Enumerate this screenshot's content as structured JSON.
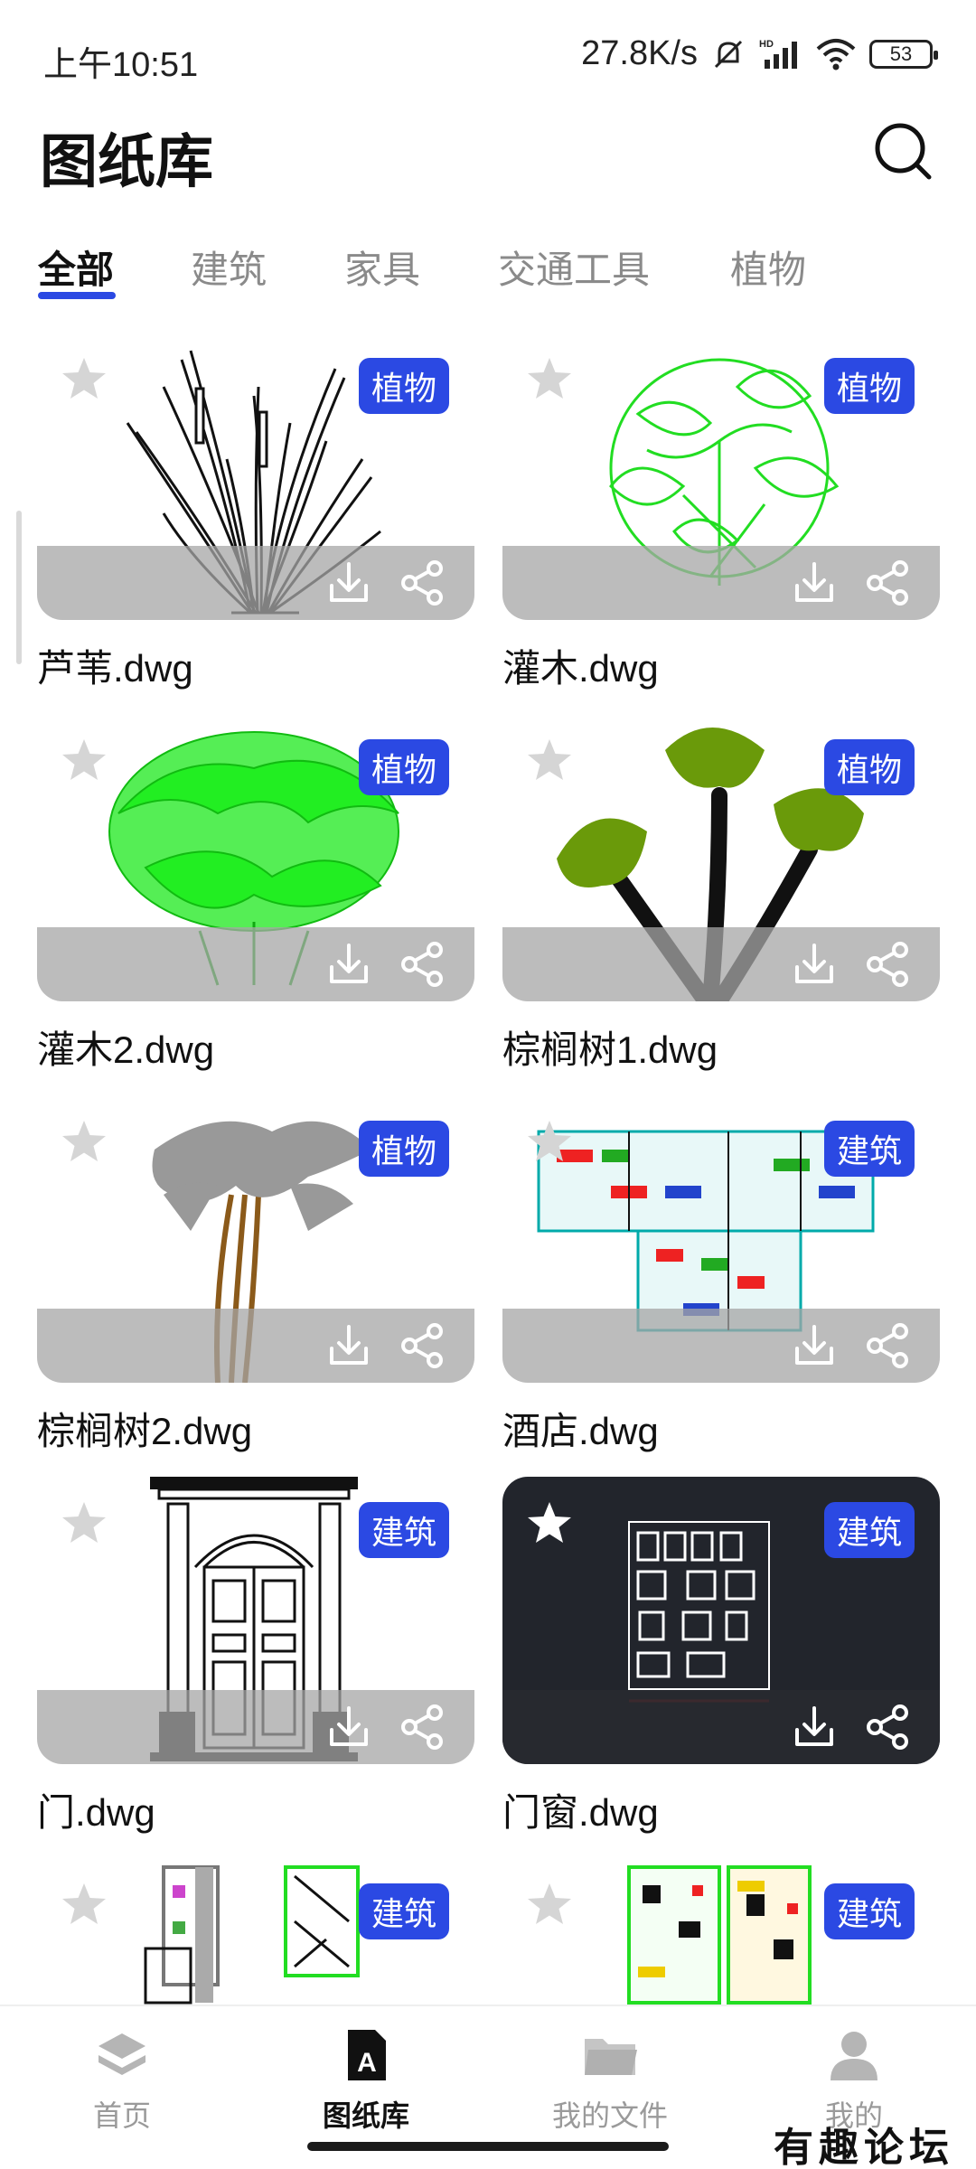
{
  "status_bar": {
    "time": "上午10:51",
    "net_speed": "27.8K/s",
    "battery": "53",
    "icons": [
      "mute-bell-icon",
      "hd-signal-icon",
      "wifi-icon",
      "battery-icon"
    ]
  },
  "header": {
    "title": "图纸库",
    "search_icon": "search-icon"
  },
  "tabs": [
    {
      "label": "全部",
      "active": true
    },
    {
      "label": "建筑",
      "active": false
    },
    {
      "label": "家具",
      "active": false
    },
    {
      "label": "交通工具",
      "active": false
    },
    {
      "label": "植物",
      "active": false
    }
  ],
  "colors": {
    "accent": "#2b49e3",
    "bar_gray": "#a5a5a5",
    "dark_card": "#22252c"
  },
  "files": [
    {
      "name": "芦苇.dwg",
      "tag": "植物",
      "art": "reed"
    },
    {
      "name": "灌木.dwg",
      "tag": "植物",
      "art": "shrub"
    },
    {
      "name": "灌木2.dwg",
      "tag": "植物",
      "art": "shrub2"
    },
    {
      "name": "棕榈树1.dwg",
      "tag": "植物",
      "art": "palm1"
    },
    {
      "name": "棕榈树2.dwg",
      "tag": "植物",
      "art": "palm2"
    },
    {
      "name": "酒店.dwg",
      "tag": "建筑",
      "art": "hotel"
    },
    {
      "name": "门.dwg",
      "tag": "建筑",
      "art": "door"
    },
    {
      "name": "门窗.dwg",
      "tag": "建筑",
      "art": "windows"
    },
    {
      "tag": "建筑",
      "art": "plan1"
    },
    {
      "tag": "建筑",
      "art": "plan2"
    }
  ],
  "bottom_nav": [
    {
      "label": "首页",
      "icon": "layers-icon",
      "active": false
    },
    {
      "label": "图纸库",
      "icon": "drawing-library-icon",
      "active": true
    },
    {
      "label": "我的文件",
      "icon": "folder-icon",
      "active": false
    },
    {
      "label": "我的",
      "icon": "person-icon",
      "active": false
    }
  ],
  "watermark": "有趣论坛"
}
